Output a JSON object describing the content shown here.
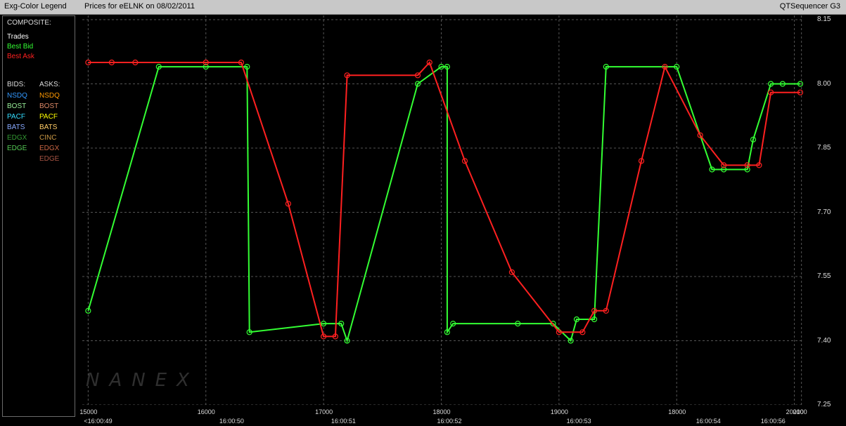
{
  "titlebar": {
    "legend_title": "Exg-Color Legend",
    "chart_title": "Prices for  eELNK  on  08/02/2011",
    "app_title": "QTSequencer G3"
  },
  "legend": {
    "composite_header": "COMPOSITE:",
    "composite": [
      {
        "label": "Trades",
        "color": "#ffffff"
      },
      {
        "label": "Best Bid",
        "color": "#33ff33"
      },
      {
        "label": "Best Ask",
        "color": "#ff2020"
      }
    ],
    "bids_header": "BIDS:",
    "asks_header": "ASKS:",
    "bids": [
      {
        "label": "NSDQ",
        "color": "#3399ff"
      },
      {
        "label": "BOST",
        "color": "#99ee99"
      },
      {
        "label": "PACF",
        "color": "#33ddff"
      },
      {
        "label": "BATS",
        "color": "#88aaff"
      },
      {
        "label": "EDGX",
        "color": "#339933"
      },
      {
        "label": "EDGE",
        "color": "#55cc55"
      }
    ],
    "asks": [
      {
        "label": "NSDQ",
        "color": "#ff9900"
      },
      {
        "label": "BOST",
        "color": "#dd8866"
      },
      {
        "label": "PACF",
        "color": "#ffff00"
      },
      {
        "label": "BATS",
        "color": "#ffcc66"
      },
      {
        "label": "CINC",
        "color": "#cc9944"
      },
      {
        "label": "EDGX",
        "color": "#cc6644"
      },
      {
        "label": "EDGE",
        "color": "#aa5544"
      }
    ]
  },
  "watermark": "NANEX",
  "chart_data": {
    "type": "line",
    "title": "Prices for  eELNK  on  08/02/2011",
    "ylim": [
      7.25,
      8.15
    ],
    "xlim": [
      14950,
      21080
    ],
    "y_ticks": [
      "8.15",
      "8.00",
      "7.85",
      "7.70",
      "7.55",
      "7.40",
      "7.25"
    ],
    "y_tick_values": [
      8.15,
      8.0,
      7.85,
      7.7,
      7.55,
      7.4,
      7.25
    ],
    "x_ticks": [
      {
        "label": "15000",
        "x": 15000
      },
      {
        "label": "16000",
        "x": 16000
      },
      {
        "label": "17000",
        "x": 17000
      },
      {
        "label": "18000",
        "x": 18000
      },
      {
        "label": "19000",
        "x": 19000
      },
      {
        "label": "18000",
        "x": 20000
      },
      {
        "label": "20000",
        "x": 21000
      },
      {
        "label": "2100",
        "x": 21060
      }
    ],
    "time_labels": [
      {
        "label": "<16:00:49",
        "x": 15000
      },
      {
        "label": "16:00:50",
        "x": 16150
      },
      {
        "label": "16:00:51",
        "x": 17100
      },
      {
        "label": "16:00:52",
        "x": 18000
      },
      {
        "label": "16:00:53",
        "x": 19100
      },
      {
        "label": "16:00:54",
        "x": 20200
      },
      {
        "label": "16:00:56",
        "x": 20750
      }
    ],
    "grid": true,
    "series": [
      {
        "name": "Best Bid",
        "color": "#33ff33",
        "x": [
          15000,
          15600,
          16000,
          16350,
          16370,
          17000,
          17150,
          17200,
          17800,
          18000,
          18050,
          18050,
          18100,
          18650,
          18950,
          19100,
          19150,
          19300,
          19400,
          20000,
          20300,
          20400,
          20600,
          20650,
          20800,
          20900,
          21050
        ],
        "y": [
          7.47,
          8.04,
          8.04,
          8.04,
          7.42,
          7.44,
          7.44,
          7.4,
          8.0,
          8.04,
          8.04,
          7.42,
          7.44,
          7.44,
          7.44,
          7.4,
          7.45,
          7.45,
          8.04,
          8.04,
          7.8,
          7.8,
          7.8,
          7.87,
          8.0,
          8.0,
          8.0
        ]
      },
      {
        "name": "Best Ask",
        "color": "#ff2020",
        "x": [
          15000,
          15200,
          15400,
          16000,
          16300,
          16700,
          17000,
          17100,
          17200,
          17800,
          17900,
          18200,
          18600,
          19000,
          19200,
          19300,
          19400,
          19700,
          19900,
          20200,
          20400,
          20600,
          20700,
          20800,
          21050
        ],
        "y": [
          8.05,
          8.05,
          8.05,
          8.05,
          8.05,
          7.72,
          7.41,
          7.41,
          8.02,
          8.02,
          8.05,
          7.82,
          7.56,
          7.42,
          7.42,
          7.47,
          7.47,
          7.82,
          8.04,
          7.88,
          7.81,
          7.81,
          7.81,
          7.98,
          7.98
        ]
      }
    ]
  }
}
